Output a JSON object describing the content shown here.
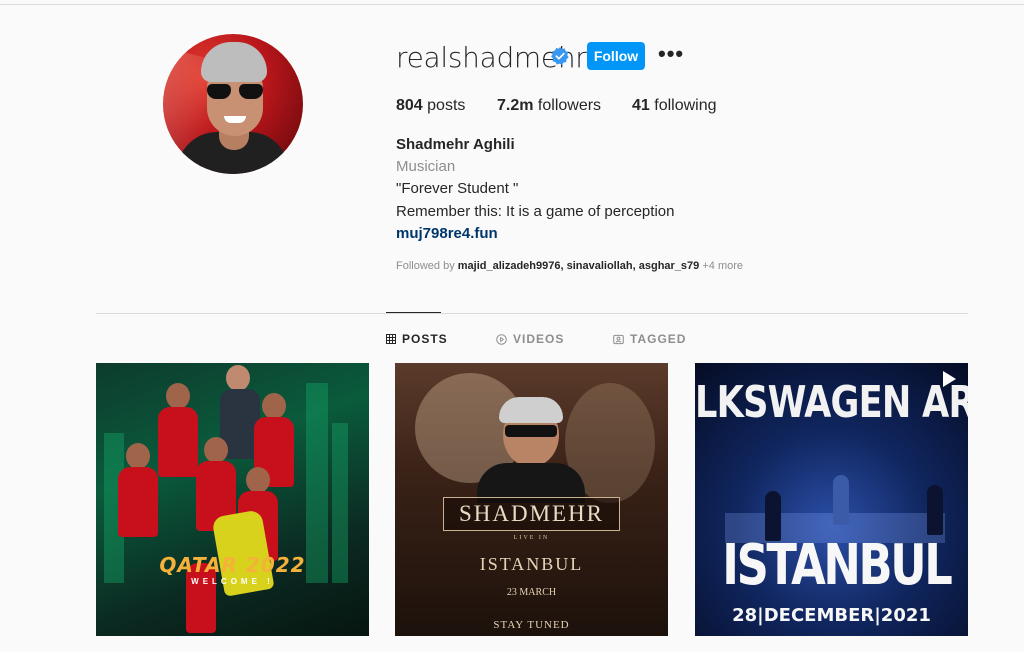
{
  "profile": {
    "username": "realshadmehr",
    "follow_label": "Follow",
    "more_label": "•••",
    "posts_count": "804",
    "posts_label": "posts",
    "followers_count": "7.2m",
    "followers_label": "followers",
    "following_count": "41",
    "following_label": "following",
    "full_name": "Shadmehr Aghili",
    "category": "Musician",
    "bio_line1": "\"Forever Student \"",
    "bio_line2": "Remember this: It is a game of perception",
    "link": "muj798re4.fun",
    "followed_by_prefix": "Followed by",
    "followed_by_names": "majid_alizadeh9976, sinavaliollah, asghar_s79",
    "followed_by_more": "+4 more",
    "verified_color": "#3897f0",
    "follow_color": "#0095f6"
  },
  "tabs": [
    {
      "label": "POSTS",
      "icon": "grid-icon",
      "active": true
    },
    {
      "label": "VIDEOS",
      "icon": "play-circle-icon",
      "active": false
    },
    {
      "label": "TAGGED",
      "icon": "tag-icon",
      "active": false
    }
  ],
  "posts": [
    {
      "caption_main": "QATAR 2022",
      "caption_sub": "WELCOME !"
    },
    {
      "title": "SHADMEHR",
      "live": "LIVE IN",
      "city": "ISTANBUL",
      "date": "23 MARCH",
      "footer": "STAY TUNED"
    },
    {
      "banner": "LKSWAGEN AR",
      "city": "ISTANBUL",
      "date": "28|DECEMBER|2021",
      "icon": "video-play-icon"
    }
  ]
}
